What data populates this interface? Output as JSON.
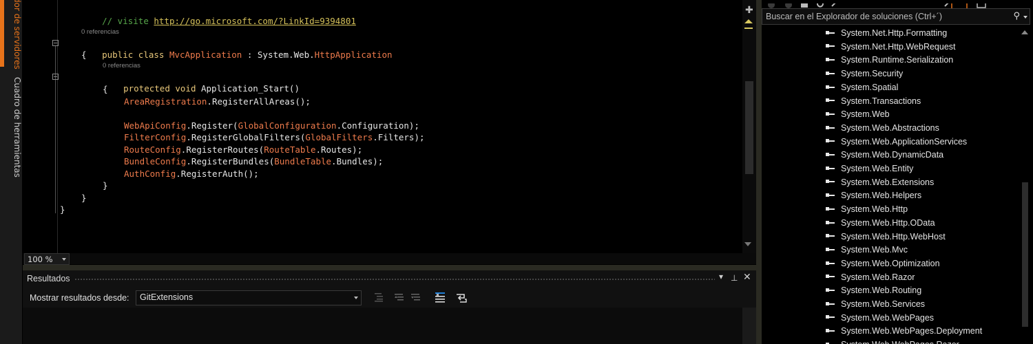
{
  "side_tabs": [
    "dor de servidores",
    "Cuadro de herramientas"
  ],
  "editor": {
    "lens_label": "0 referencias",
    "comment_prefix": "// visite ",
    "comment_link": "http://go.microsoft.com/?LinkId=9394801",
    "class_decl": {
      "kw": "public class ",
      "name": "MvcApplication",
      "sep": " : System.Web.",
      "base": "HttpApplication"
    },
    "open_brace": "{",
    "close_brace": "}",
    "method_decl": {
      "kw": "protected void ",
      "name": "Application_Start()"
    },
    "statements": [
      [
        {
          "t": "ty",
          "v": "AreaRegistration"
        },
        {
          "t": "pl",
          "v": ".RegisterAllAreas();"
        }
      ],
      [],
      [
        {
          "t": "ty",
          "v": "WebApiConfig"
        },
        {
          "t": "pl",
          "v": ".Register("
        },
        {
          "t": "ty",
          "v": "GlobalConfiguration"
        },
        {
          "t": "pl",
          "v": ".Configuration);"
        }
      ],
      [
        {
          "t": "ty",
          "v": "FilterConfig"
        },
        {
          "t": "pl",
          "v": ".RegisterGlobalFilters("
        },
        {
          "t": "ty",
          "v": "GlobalFilters"
        },
        {
          "t": "pl",
          "v": ".Filters);"
        }
      ],
      [
        {
          "t": "ty",
          "v": "RouteConfig"
        },
        {
          "t": "pl",
          "v": ".RegisterRoutes("
        },
        {
          "t": "ty",
          "v": "RouteTable"
        },
        {
          "t": "pl",
          "v": ".Routes);"
        }
      ],
      [
        {
          "t": "ty",
          "v": "BundleConfig"
        },
        {
          "t": "pl",
          "v": ".RegisterBundles("
        },
        {
          "t": "ty",
          "v": "BundleTable"
        },
        {
          "t": "pl",
          "v": ".Bundles);"
        }
      ],
      [
        {
          "t": "ty",
          "v": "AuthConfig"
        },
        {
          "t": "pl",
          "v": ".RegisterAuth();"
        }
      ]
    ]
  },
  "zoom": "100 %",
  "output_panel": {
    "title": "Resultados",
    "show_from_label": "Mostrar resultados desde:",
    "source_value": "GitExtensions"
  },
  "solution_explorer": {
    "search_placeholder": "Buscar en el Explorador de soluciones (Ctrl+´)",
    "references": [
      "System.Net.Http.Formatting",
      "System.Net.Http.WebRequest",
      "System.Runtime.Serialization",
      "System.Security",
      "System.Spatial",
      "System.Transactions",
      "System.Web",
      "System.Web.Abstractions",
      "System.Web.ApplicationServices",
      "System.Web.DynamicData",
      "System.Web.Entity",
      "System.Web.Extensions",
      "System.Web.Helpers",
      "System.Web.Http",
      "System.Web.Http.OData",
      "System.Web.Http.WebHost",
      "System.Web.Mvc",
      "System.Web.Optimization",
      "System.Web.Razor",
      "System.Web.Routing",
      "System.Web.Services",
      "System.Web.WebPages",
      "System.Web.WebPages.Deployment",
      "System.Web.WebPages.Razor"
    ]
  },
  "colors": {
    "accent": "#e8731a",
    "type": "#ee7b4c",
    "keyword": "#569cd6",
    "comment": "#57a64a"
  }
}
